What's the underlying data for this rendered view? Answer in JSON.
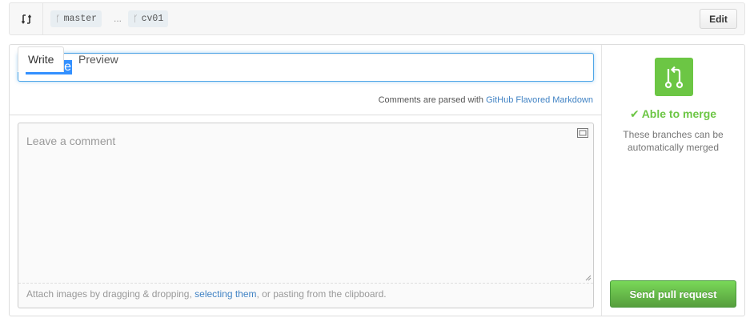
{
  "range": {
    "base_branch": "master",
    "separator": "...",
    "compare_branch": "cv01",
    "edit_label": "Edit"
  },
  "form": {
    "title_value": "riesenie",
    "tabs": [
      {
        "label": "Write",
        "active": true
      },
      {
        "label": "Preview",
        "active": false
      }
    ],
    "markdown_note_prefix": "Comments are parsed with ",
    "markdown_link": "GitHub Flavored Markdown",
    "comment_placeholder": "Leave a comment",
    "attach_prefix": "Attach images by dragging & dropping, ",
    "attach_link": "selecting them",
    "attach_suffix": ", or pasting from the clipboard."
  },
  "sidebar": {
    "merge_status": "Able to merge",
    "merge_description": "These branches can be automatically merged",
    "submit_label": "Send pull request"
  },
  "colors": {
    "success_green": "#6cc644",
    "link_blue": "#4183c4",
    "focus_blue": "#51a7e8"
  },
  "icons": {
    "range": "git-compare-icon",
    "branch": "git-branch-icon",
    "merge": "git-pull-request-icon",
    "check": "check-icon",
    "fullscreen": "fullscreen-icon"
  }
}
